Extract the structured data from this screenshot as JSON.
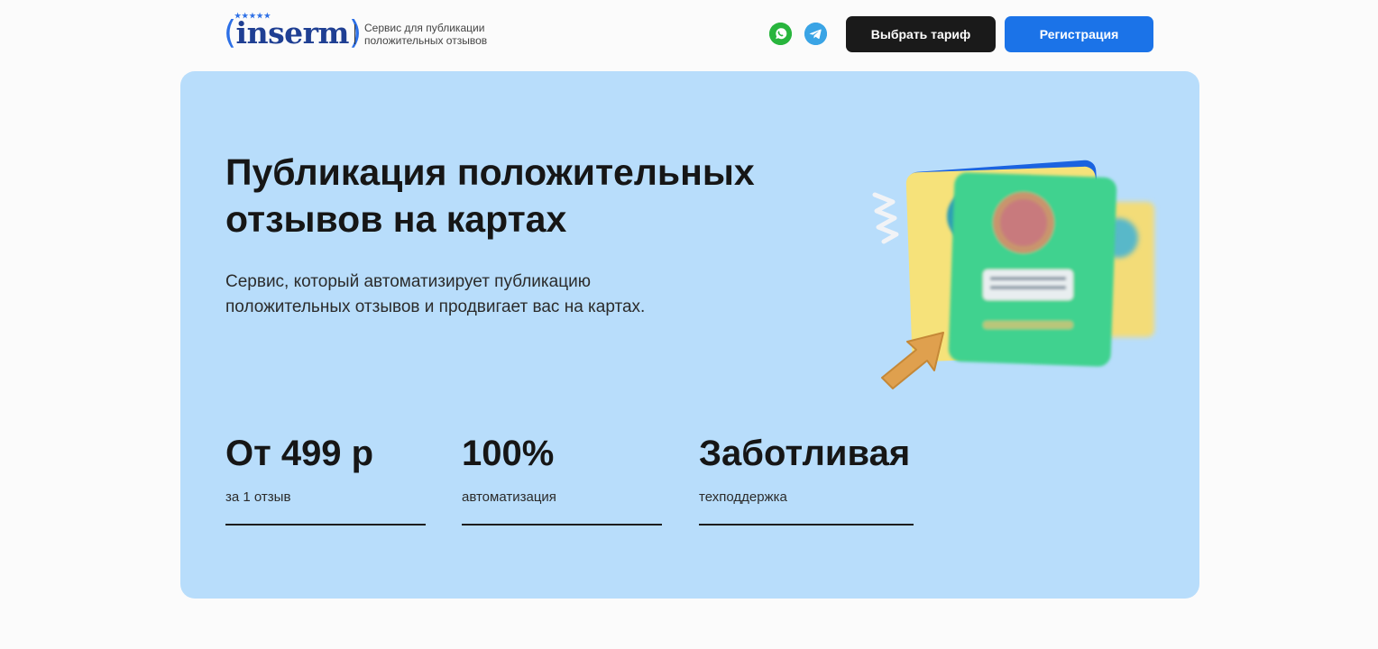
{
  "header": {
    "logo": {
      "text": "inserm",
      "stars": "★★★★★"
    },
    "tagline": "Сервис для публикации положительных отзывов",
    "social": [
      {
        "name": "whatsapp-icon"
      },
      {
        "name": "telegram-icon"
      }
    ],
    "choose_plan_label": "Выбрать тариф",
    "register_label": "Регистрация"
  },
  "hero": {
    "title": "Публикация положительных отзывов на картах",
    "subtitle": "Сервис, который автоматизирует публикацию положительных отзывов и продвигает вас на картах.",
    "stats": [
      {
        "value": "От 499 р",
        "caption": "за 1 отзыв"
      },
      {
        "value": "100%",
        "caption": "автоматизация"
      },
      {
        "value": "Заботливая",
        "caption": "техподдержка"
      }
    ]
  },
  "colors": {
    "page_bg": "#fbfbfb",
    "hero_bg": "#b8ddfb",
    "primary_blue": "#1b73e8",
    "dark_button": "#1a1a1a",
    "whatsapp_green": "#28b53d",
    "telegram_blue": "#3aa4e5",
    "card_green": "#3fd28f",
    "card_yellow": "#f6e27a"
  }
}
